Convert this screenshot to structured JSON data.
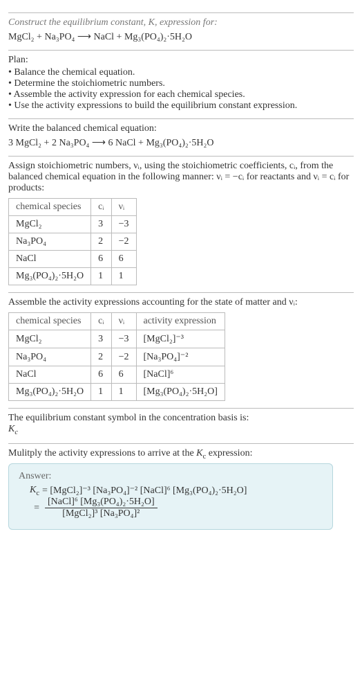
{
  "intro": {
    "prompt": "Construct the equilibrium constant, K, expression for:",
    "equation": "MgCl₂ + Na₃PO₄ ⟶ NaCl + Mg₃(PO₄)₂·5H₂O"
  },
  "plan": {
    "heading": "Plan:",
    "items": [
      "• Balance the chemical equation.",
      "• Determine the stoichiometric numbers.",
      "• Assemble the activity expression for each chemical species.",
      "• Use the activity expressions to build the equilibrium constant expression."
    ]
  },
  "balanced": {
    "lead": "Write the balanced chemical equation:",
    "equation": "3 MgCl₂ + 2 Na₃PO₄ ⟶ 6 NaCl + Mg₃(PO₄)₂·5H₂O"
  },
  "assign": {
    "text1": "Assign stoichiometric numbers, νᵢ, using the stoichiometric coefficients, cᵢ, from the balanced chemical equation in the following manner: νᵢ = −cᵢ for reactants and νᵢ = cᵢ for products:",
    "headers": [
      "chemical species",
      "cᵢ",
      "νᵢ"
    ],
    "rows": [
      [
        "MgCl₂",
        "3",
        "−3"
      ],
      [
        "Na₃PO₄",
        "2",
        "−2"
      ],
      [
        "NaCl",
        "6",
        "6"
      ],
      [
        "Mg₃(PO₄)₂·5H₂O",
        "1",
        "1"
      ]
    ]
  },
  "activity": {
    "lead": "Assemble the activity expressions accounting for the state of matter and νᵢ:",
    "headers": [
      "chemical species",
      "cᵢ",
      "νᵢ",
      "activity expression"
    ],
    "rows": [
      [
        "MgCl₂",
        "3",
        "−3",
        "[MgCl₂]⁻³"
      ],
      [
        "Na₃PO₄",
        "2",
        "−2",
        "[Na₃PO₄]⁻²"
      ],
      [
        "NaCl",
        "6",
        "6",
        "[NaCl]⁶"
      ],
      [
        "Mg₃(PO₄)₂·5H₂O",
        "1",
        "1",
        "[Mg₃(PO₄)₂·5H₂O]"
      ]
    ]
  },
  "symbol": {
    "lead": "The equilibrium constant symbol in the concentration basis is:",
    "value": "K_c"
  },
  "multiply": {
    "lead": "Mulitply the activity expressions to arrive at the K_c expression:"
  },
  "answer": {
    "label": "Answer:",
    "lhs": "K_c",
    "line1": "= [MgCl₂]⁻³ [Na₃PO₄]⁻² [NaCl]⁶ [Mg₃(PO₄)₂·5H₂O]",
    "eq2": "=",
    "frac_num": "[NaCl]⁶ [Mg₃(PO₄)₂·5H₂O]",
    "frac_den": "[MgCl₂]³ [Na₃PO₄]²"
  }
}
